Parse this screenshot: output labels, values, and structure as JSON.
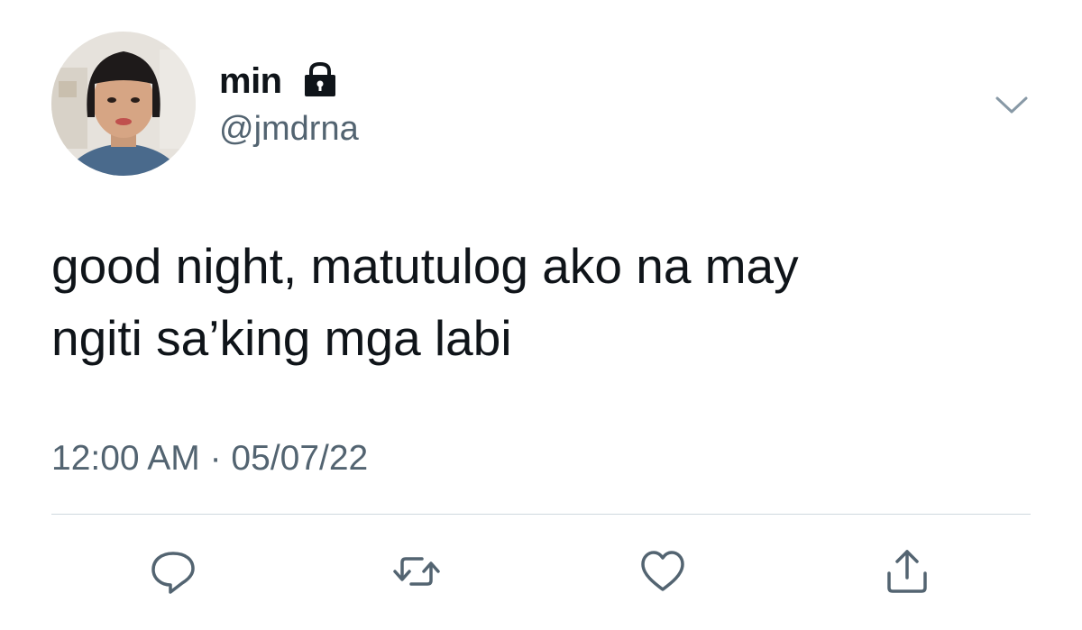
{
  "tweet": {
    "display_name": "min",
    "handle": "@jmdrna",
    "text": "good night, matutulog ako na may\nngiti sa’king mga labi",
    "timestamp": "12:00 AM · 05/07/22",
    "protected": true
  },
  "icons": {
    "lock": "lock-icon",
    "menu": "chevron-down-icon",
    "reply": "reply-icon",
    "retweet": "retweet-icon",
    "like": "heart-icon",
    "share": "share-icon"
  },
  "colors": {
    "text_primary": "#0f1419",
    "text_secondary": "#536471",
    "icon": "#536471",
    "divider": "#cfd9de",
    "background": "#ffffff"
  }
}
